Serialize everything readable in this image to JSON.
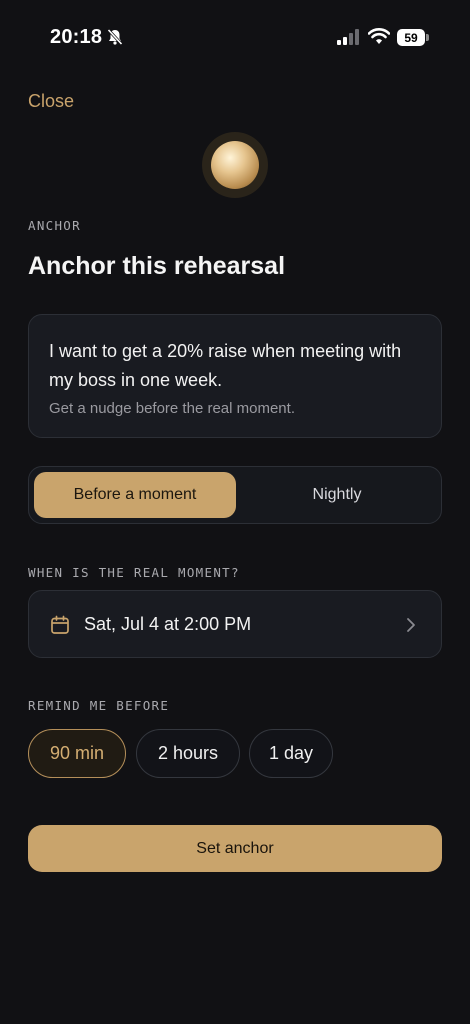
{
  "status_bar": {
    "time": "20:18",
    "battery": "59",
    "icons": [
      "bell-slash-icon",
      "cellular-signal-icon",
      "wifi-icon",
      "battery-icon"
    ]
  },
  "header": {
    "close_label": "Close"
  },
  "section": {
    "label": "ANCHOR",
    "title": "Anchor this rehearsal"
  },
  "goal_card": {
    "text": "I want to get a 20% raise when meeting with my boss in one week.",
    "subtext": "Get a nudge before the real moment."
  },
  "mode_toggle": {
    "options": [
      "Before a moment",
      "Nightly"
    ],
    "selected": "Before a moment"
  },
  "moment": {
    "label": "WHEN IS THE REAL MOMENT?",
    "value": "Sat, Jul 4 at 2:00 PM",
    "icon": "calendar-icon"
  },
  "reminder": {
    "label": "REMIND ME BEFORE",
    "options": [
      "90 min",
      "2 hours",
      "1 day"
    ],
    "selected": "90 min"
  },
  "actions": {
    "primary_label": "Set anchor"
  },
  "colors": {
    "background": "#111114",
    "accent": "#c9a46c",
    "card": "#191b21"
  }
}
